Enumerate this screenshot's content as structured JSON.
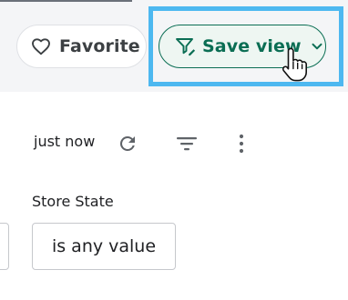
{
  "header": {
    "favorite_label": "Favorite",
    "save_view_label": "Save view"
  },
  "toolbar": {
    "timestamp": "just now",
    "icons": [
      "refresh-icon",
      "filter-icon",
      "more-vert-icon"
    ]
  },
  "filter": {
    "label": "Store State",
    "value": "is any value"
  },
  "colors": {
    "accent_green": "#0b6e54",
    "highlight_blue": "#4db8f0",
    "header_bg": "#f4f5f7"
  }
}
